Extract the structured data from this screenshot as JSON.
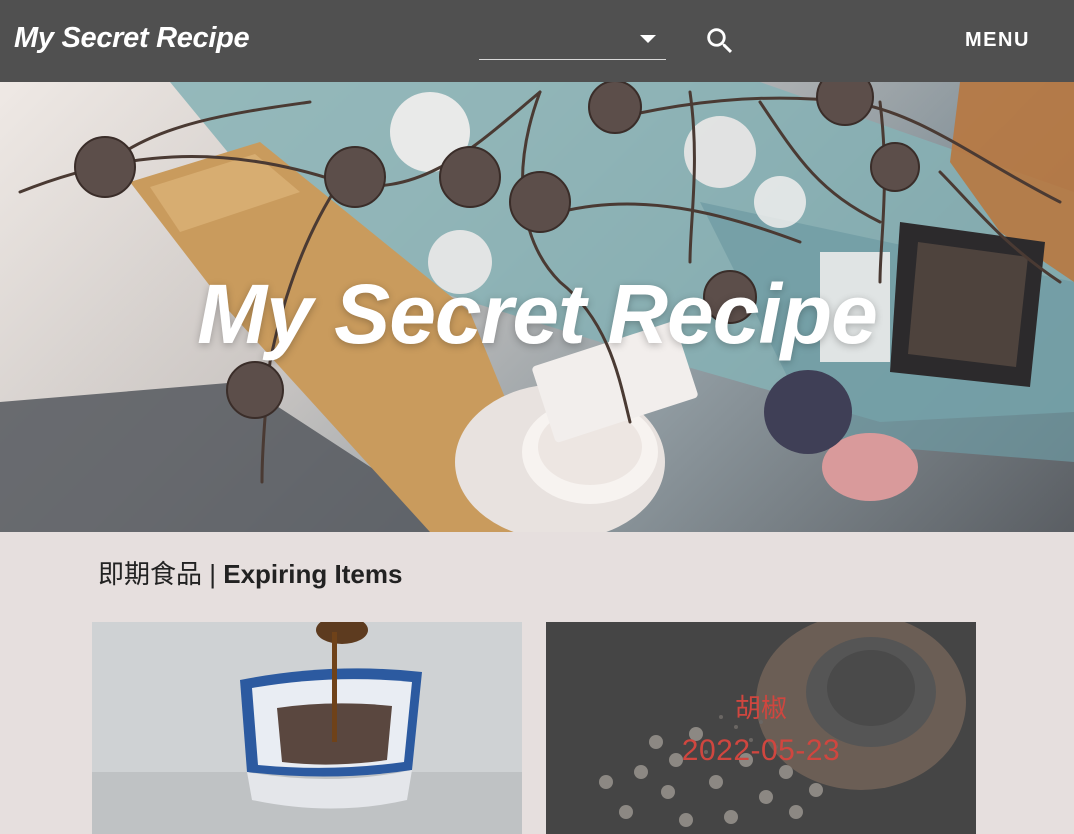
{
  "header": {
    "brand": "My Secret Recipe",
    "select_value": "",
    "menu_label": "MENU"
  },
  "hero": {
    "title": "My Secret Recipe"
  },
  "section": {
    "heading_zh": "即期食品",
    "heading_sep": "|",
    "heading_en": "Expiring Items"
  },
  "cards": [
    {
      "name": "",
      "date": ""
    },
    {
      "name": "胡椒",
      "date": "2022-05-23"
    }
  ],
  "colors": {
    "header_bg": "#505050",
    "page_bg": "#e6dfde",
    "overlay_text": "#d0463f"
  },
  "icons": {
    "search": "search-icon",
    "caret": "chevron-down-icon"
  }
}
